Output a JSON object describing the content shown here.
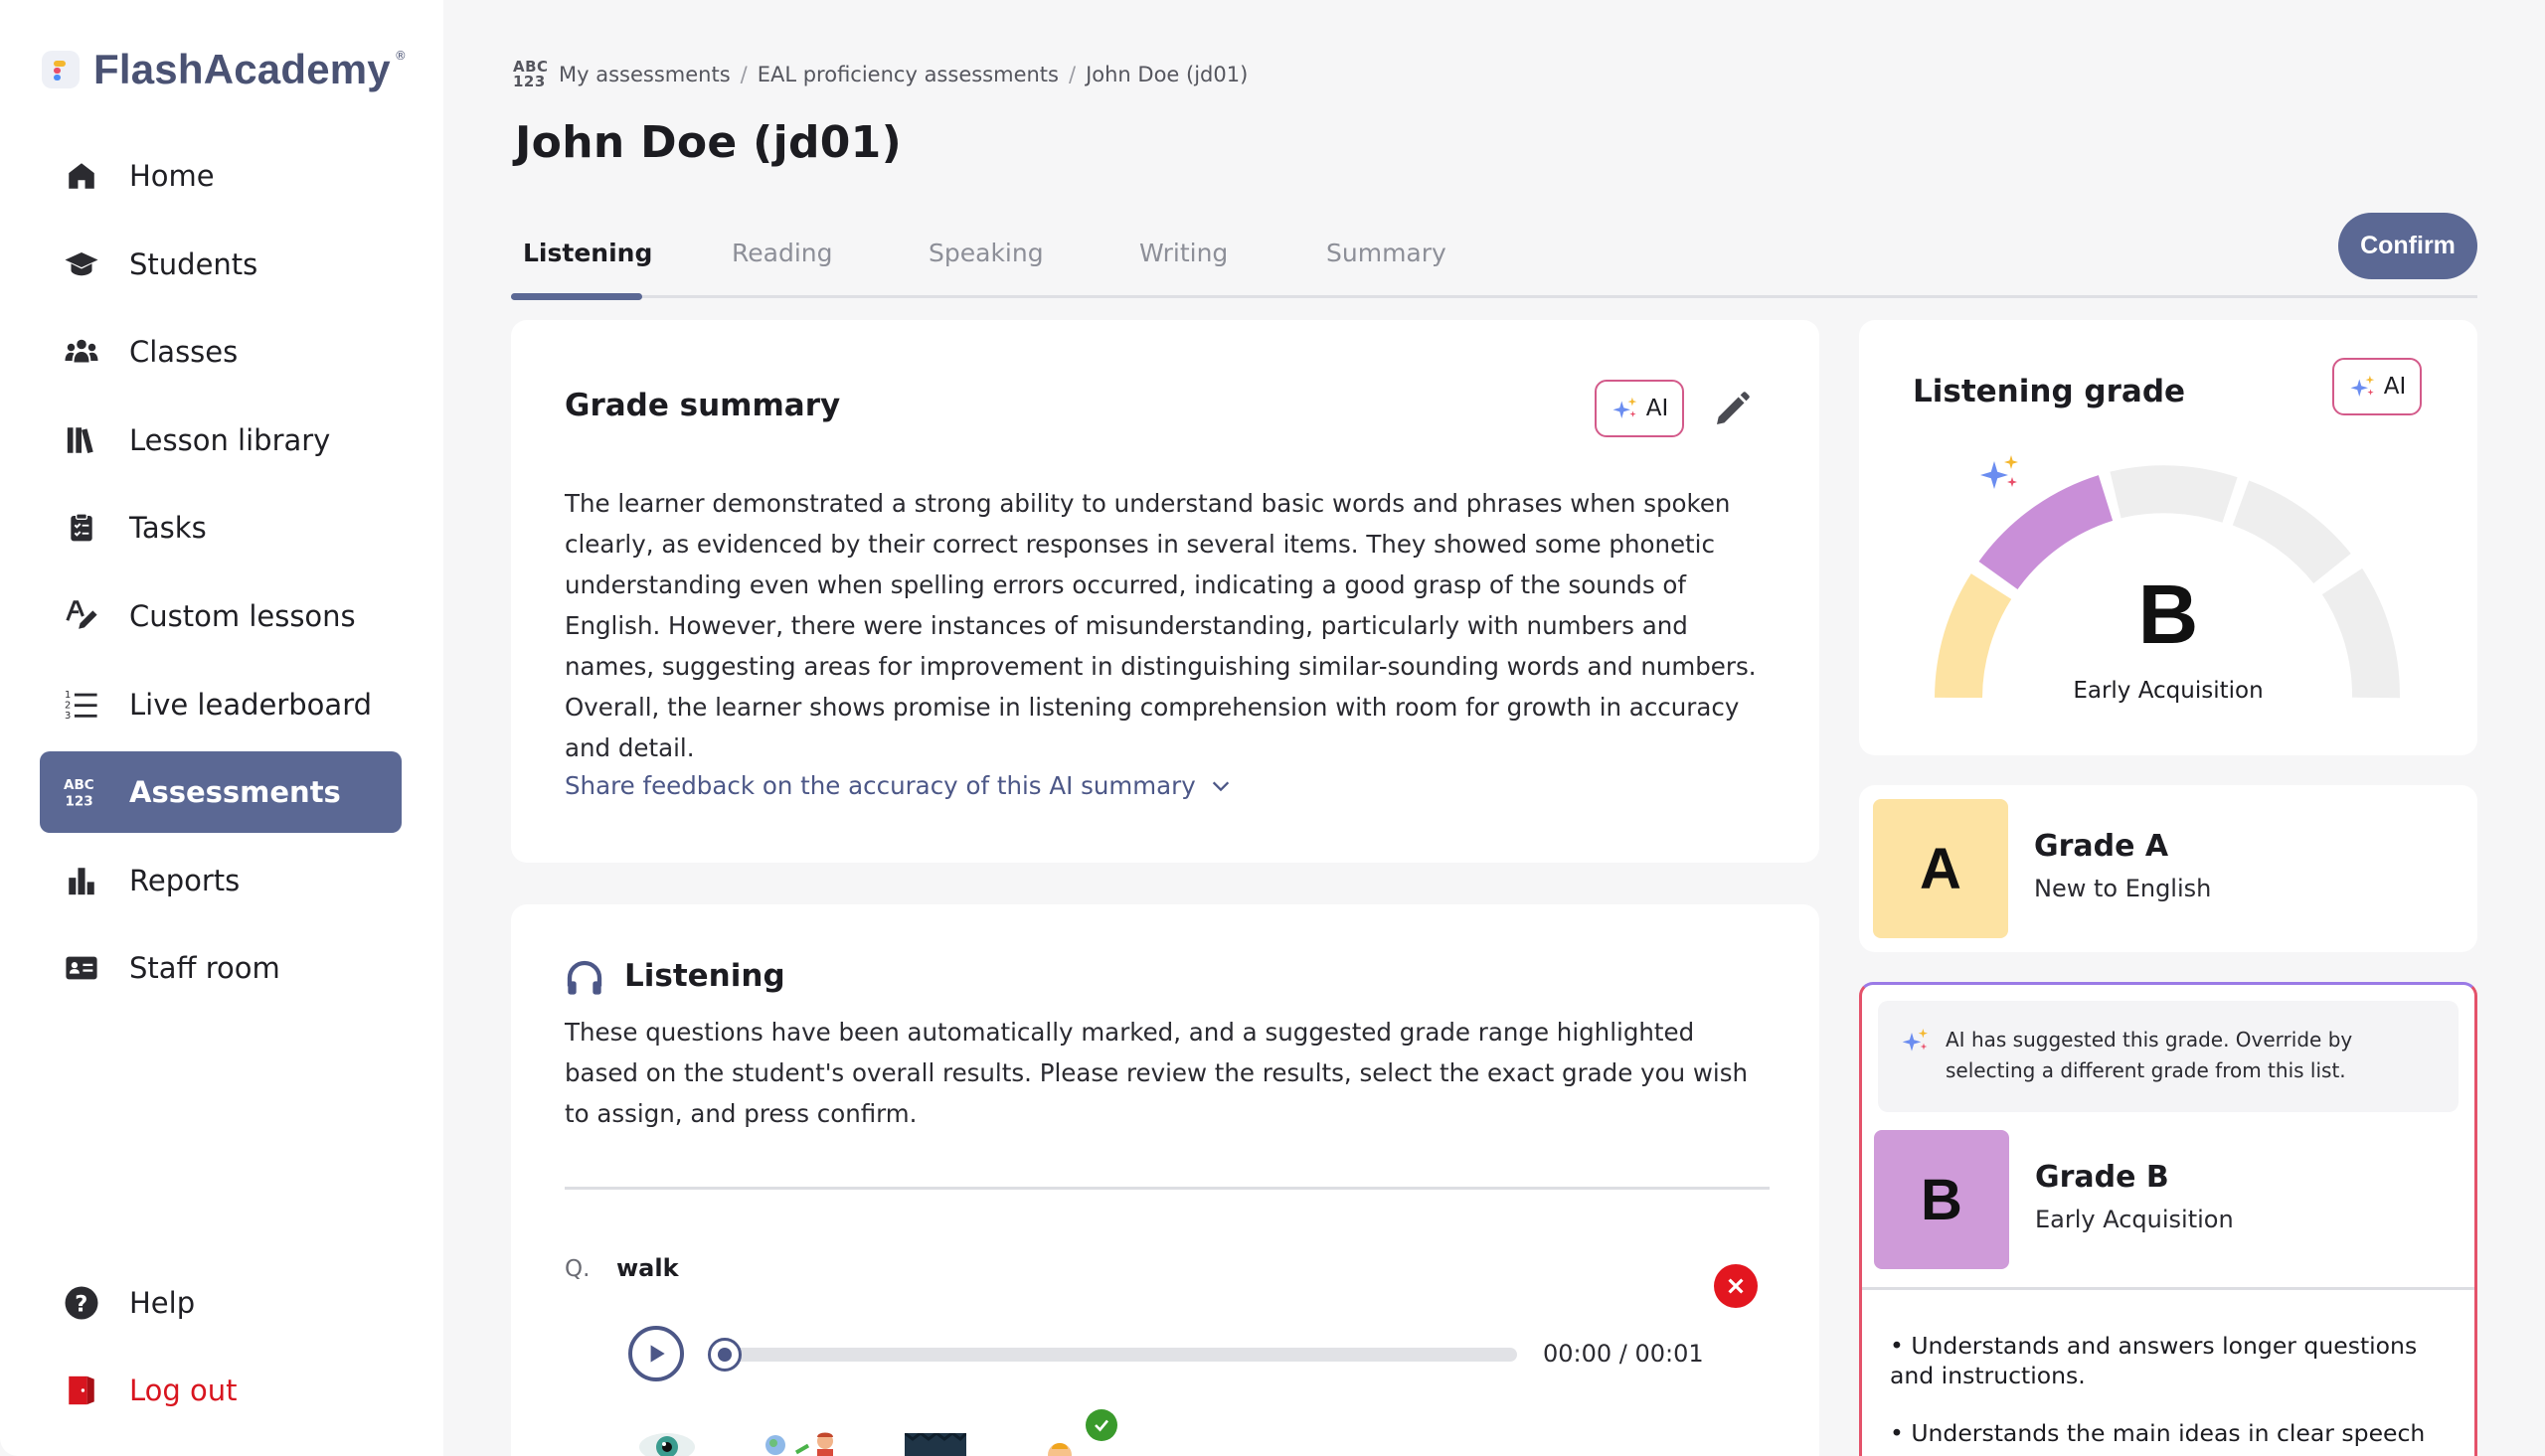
{
  "app": {
    "brand": "FlashAcademy",
    "brand_mark": "®"
  },
  "sidebar": {
    "items": [
      {
        "label": "Home",
        "icon": "home-icon"
      },
      {
        "label": "Students",
        "icon": "graduation-cap-icon"
      },
      {
        "label": "Classes",
        "icon": "group-icon"
      },
      {
        "label": "Lesson library",
        "icon": "books-icon"
      },
      {
        "label": "Tasks",
        "icon": "clipboard-check-icon"
      },
      {
        "label": "Custom lessons",
        "icon": "pen-letter-icon"
      },
      {
        "label": "Live leaderboard",
        "icon": "numbered-list-icon"
      },
      {
        "label": "Assessments",
        "icon": "abc-123-icon",
        "active": true
      },
      {
        "label": "Reports",
        "icon": "bar-chart-icon"
      },
      {
        "label": "Staff room",
        "icon": "id-card-icon"
      }
    ],
    "bottom": [
      {
        "label": "Help",
        "icon": "help-circle-icon"
      },
      {
        "label": "Log out",
        "icon": "door-exit-icon",
        "color": "#d8151f"
      }
    ]
  },
  "breadcrumb": {
    "icon_text_top": "ABC",
    "icon_text_bottom": "123",
    "items": [
      "My assessments",
      "EAL proficiency assessments",
      "John Doe (jd01)"
    ],
    "separator": "/"
  },
  "page": {
    "title": "John Doe (jd01)"
  },
  "tabs": {
    "items": [
      "Listening",
      "Reading",
      "Speaking",
      "Writing",
      "Summary"
    ],
    "active": "Listening",
    "confirm_label": "Confirm"
  },
  "summary": {
    "title": "Grade summary",
    "ai_label": "AI",
    "body": "The learner demonstrated a strong ability to understand basic words and phrases when spoken clearly, as evidenced by their correct responses in several items. They showed some phonetic understanding even when spelling errors occurred, indicating a good grasp of the sounds of English. However, there were instances of misunderstanding, particularly with numbers and names, suggesting areas for improvement in distinguishing similar-sounding words and numbers. Overall, the learner shows promise in listening comprehension with room for growth in accuracy and detail.",
    "feedback_link": "Share feedback on the accuracy of this AI summary"
  },
  "listening": {
    "title": "Listening",
    "description": "These questions have been automatically marked, and a suggested grade range highlighted based on the student's overall results. Please review the results, select the exact grade you wish to assign, and press confirm.",
    "question_prefix": "Q.",
    "question_word": "walk",
    "result": "incorrect",
    "audio_time": "00:00 / 00:01",
    "audio_progress": 0
  },
  "listening_grade": {
    "title": "Listening grade",
    "ai_label": "AI",
    "grade_letter": "B",
    "grade_label": "Early Acquisition",
    "colors": {
      "A": "#fde3a3",
      "B": "#c98fd8",
      "rest": "#eeeeee"
    }
  },
  "grades": [
    {
      "letter": "A",
      "name": "Grade A",
      "desc": "New to English",
      "color": "#fde3a3"
    },
    {
      "letter": "B",
      "name": "Grade B",
      "desc": "Early Acquisition",
      "color": "#cf9bd9",
      "suggested": true
    }
  ],
  "ai_suggestion": {
    "text": "AI has suggested this grade. Override by selecting a different grade from this list."
  },
  "grade_b_points": [
    "• Understands and answers longer questions and instructions.",
    "• Understands the main ideas in clear speech"
  ],
  "colors": {
    "accent": "#5b6894",
    "link": "#4c5787",
    "error": "#e3161f",
    "logout": "#d8151f"
  }
}
